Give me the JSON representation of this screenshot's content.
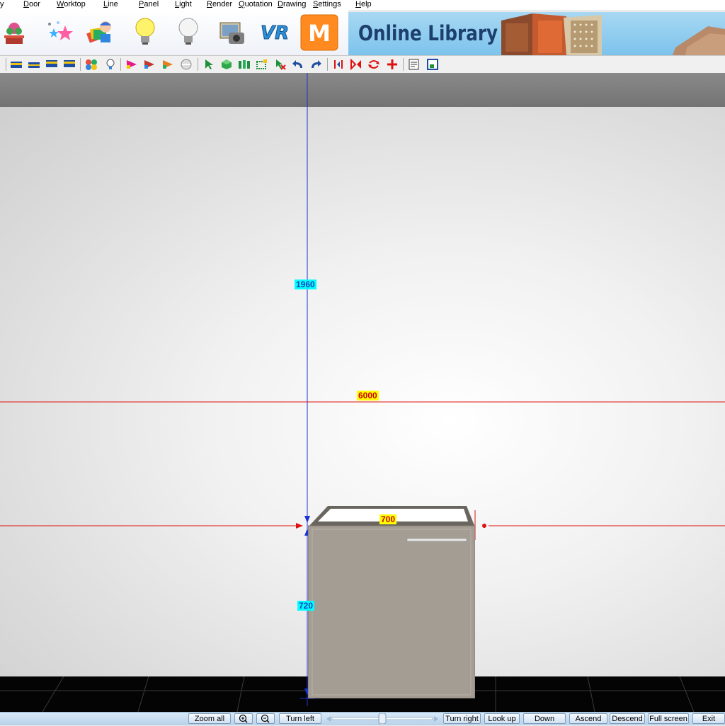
{
  "menu": {
    "items": [
      {
        "label": "y",
        "hotkey": ""
      },
      {
        "label": "Door",
        "hotkey": "D"
      },
      {
        "label": "Worktop",
        "hotkey": "W"
      },
      {
        "label": "Line",
        "hotkey": "L"
      },
      {
        "label": "Panel",
        "hotkey": "P"
      },
      {
        "label": "Light",
        "hotkey": "L"
      },
      {
        "label": "Render",
        "hotkey": "R"
      },
      {
        "label": "Quotation",
        "hotkey": "Q"
      },
      {
        "label": "Drawing",
        "hotkey": "D"
      },
      {
        "label": "Settings",
        "hotkey": "S"
      },
      {
        "label": "Help",
        "hotkey": "H"
      }
    ]
  },
  "big_toolbar": {
    "icons": [
      "plant-icon",
      "sparkle-icon",
      "cards-person-icon",
      "bulb-on-icon",
      "bulb-off-icon",
      "camera-photo-icon",
      "vr-icon",
      "m-logo-icon"
    ],
    "vr_text": "VR",
    "m_text": "M"
  },
  "banner": {
    "title": "Online Library"
  },
  "viewport": {
    "dimensions": {
      "wall_height": "1960",
      "wall_width": "6000",
      "cabinet_width": "700",
      "cabinet_height": "720"
    },
    "colors": {
      "vertical_guide": "#1a33d1",
      "horizontal_guide": "#e01010",
      "cabinet": "#a39d94",
      "wall": "#f2f2f2",
      "floor": "#050505"
    }
  },
  "statusbar": {
    "zoom_all": "Zoom all",
    "zoom_in_icon": "zoom-in-icon",
    "zoom_out_icon": "zoom-out-icon",
    "turn_left": "Turn left",
    "turn_right": "Turn right",
    "look_up": "Look up",
    "down": "Down",
    "ascend": "Ascend",
    "descend": "Descend",
    "full_screen": "Full screen",
    "exit": "Exit",
    "slider_level": 0.5
  }
}
